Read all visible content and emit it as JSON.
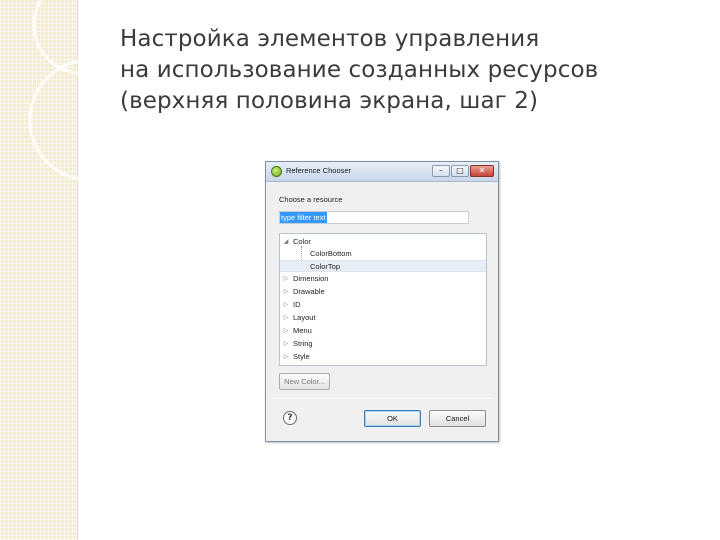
{
  "slide": {
    "title_lines": [
      "Настройка элементов управления",
      "на использование созданных ресурсов",
      "(верхняя половина экрана, шаг 2)"
    ]
  },
  "dialog": {
    "title": "Reference Chooser",
    "window_buttons": {
      "minimize": "–",
      "maximize": "□",
      "close": "✕"
    },
    "section_label": "Choose a resource",
    "filter": {
      "value": "",
      "placeholder": "type filter text",
      "selected_text": "type filter text"
    },
    "tree": [
      {
        "label": "Color",
        "expanded": true,
        "children": [
          "ColorBottom",
          "ColorTop"
        ]
      },
      {
        "label": "Dimension"
      },
      {
        "label": "Drawable"
      },
      {
        "label": "ID"
      },
      {
        "label": "Layout"
      },
      {
        "label": "Menu"
      },
      {
        "label": "String"
      },
      {
        "label": "Style"
      }
    ],
    "icons": {
      "expanded": "triangle-down-icon",
      "collapsed": "triangle-right-icon",
      "help": "question-icon"
    },
    "new_color_label": "New Color...",
    "help_glyph": "?",
    "ok_label": "OK",
    "cancel_label": "Cancel",
    "colors": {
      "selection": "#3399ff",
      "dialog_bg": "#f0f0f0",
      "strip": "#f3ecd2"
    }
  }
}
